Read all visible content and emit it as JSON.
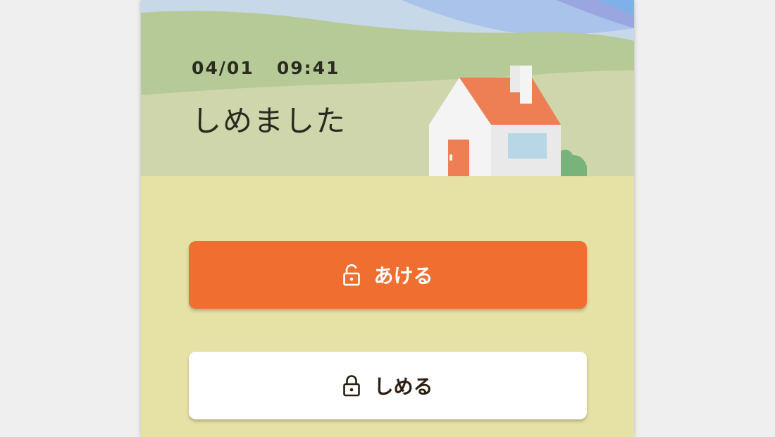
{
  "status": {
    "date": "04/01",
    "time": "09:41",
    "message": "しめました"
  },
  "actions": {
    "open_label": "あける",
    "close_label": "しめる"
  },
  "colors": {
    "primary": "#f06f30",
    "background": "#e6e1a5",
    "roof": "#ee7f55",
    "door": "#ee7f55",
    "sky": "#c7d8e8"
  },
  "icons": {
    "open": "unlocked-padlock-icon",
    "close": "locked-padlock-icon"
  }
}
